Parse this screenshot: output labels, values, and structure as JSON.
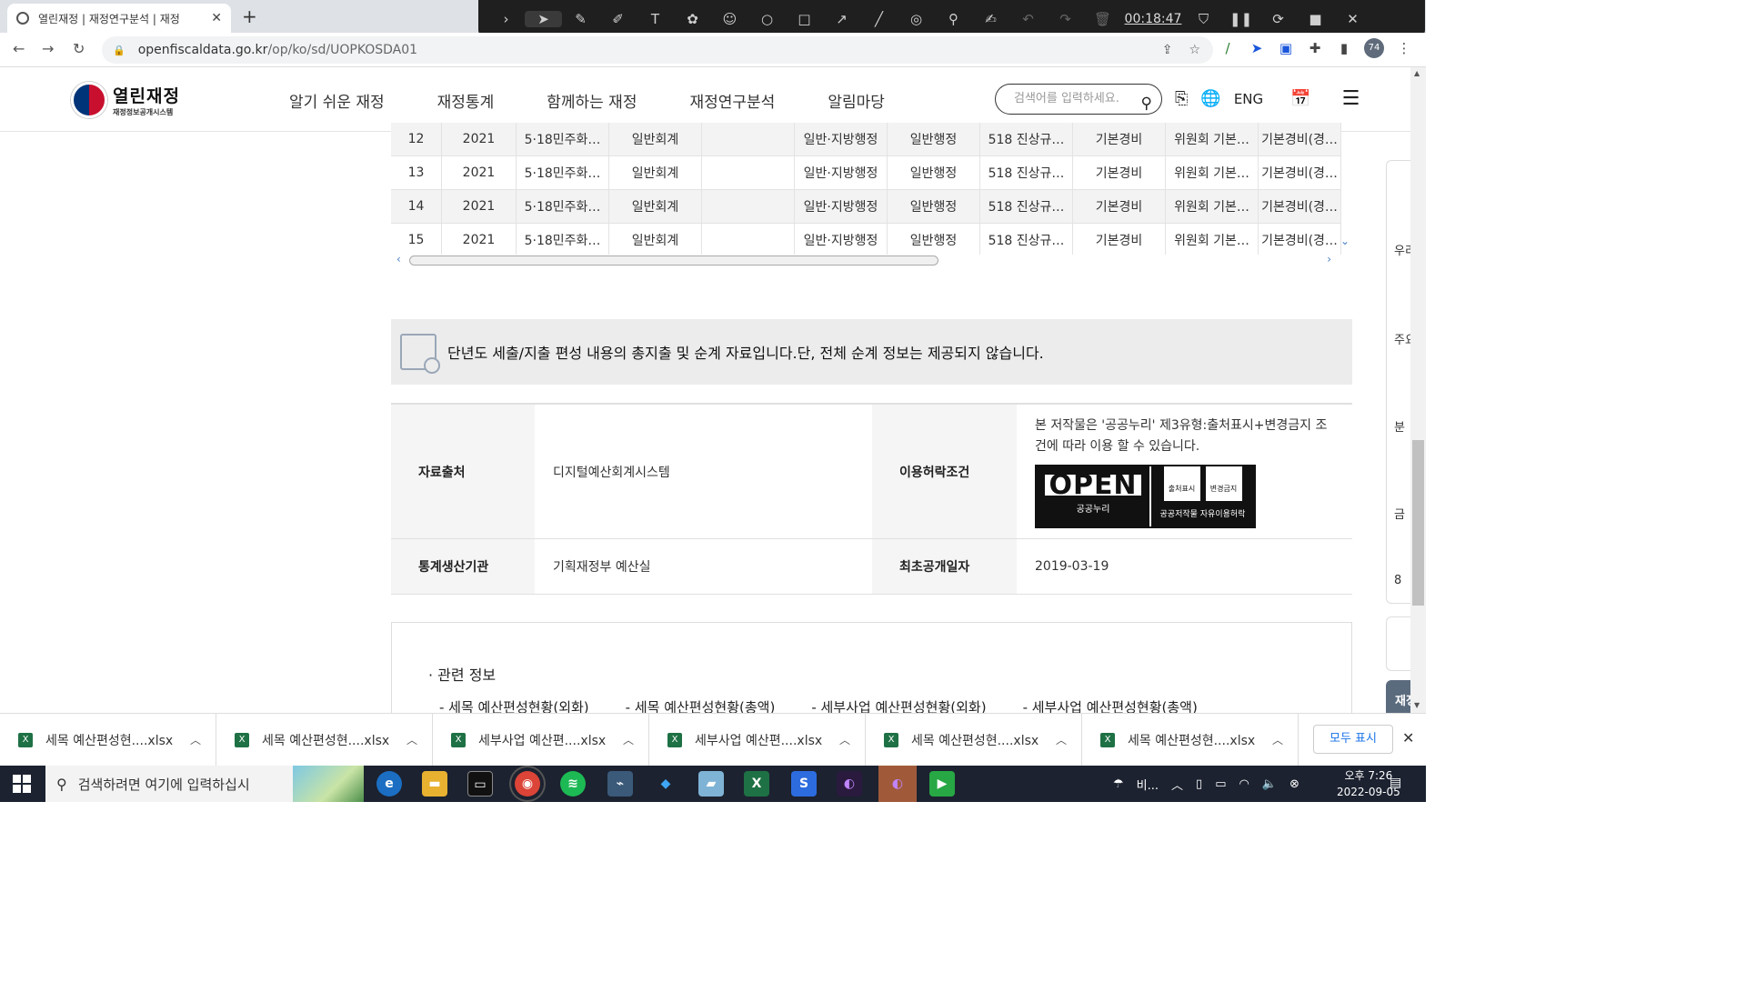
{
  "browser": {
    "tab_title": "열린재정 | 재정연구분석 | 재정",
    "url_host": "openfiscaldata.go.kr",
    "url_path": "/op/ko/sd/UOPKOSDA01",
    "profile_badge": "74"
  },
  "recorder": {
    "timer": "00:18:47"
  },
  "site": {
    "logo_title": "열린재정",
    "logo_subtitle": "재정정보공개시스템",
    "nav": [
      "알기 쉬운 재정",
      "재정통계",
      "함께하는 재정",
      "재정연구분석",
      "알림마당"
    ],
    "search_placeholder": "검색어를 입력하세요.",
    "lang": "ENG"
  },
  "table": {
    "rows": [
      [
        "12",
        "2021",
        "5·18민주화…",
        "일반회계",
        "",
        "일반·지방행정",
        "일반행정",
        "518 진상규…",
        "기본경비",
        "위원회 기본…",
        "기본경비(경…"
      ],
      [
        "13",
        "2021",
        "5·18민주화…",
        "일반회계",
        "",
        "일반·지방행정",
        "일반행정",
        "518 진상규…",
        "기본경비",
        "위원회 기본…",
        "기본경비(경…"
      ],
      [
        "14",
        "2021",
        "5·18민주화…",
        "일반회계",
        "",
        "일반·지방행정",
        "일반행정",
        "518 진상규…",
        "기본경비",
        "위원회 기본…",
        "기본경비(경…"
      ],
      [
        "15",
        "2021",
        "5·18민주화…",
        "일반회계",
        "",
        "일반·지방행정",
        "일반행정",
        "518 진상규…",
        "기본경비",
        "위원회 기본…",
        "기본경비(경…"
      ]
    ]
  },
  "notice": {
    "text": "단년도 세출/지출 편성 내용의 총지출 및 순계 자료입니다.단, 전체 순계 정보는 제공되지 않습니다."
  },
  "info": {
    "source_label": "자료출처",
    "source_value": "디지털예산회계시스템",
    "license_label": "이용허락조건",
    "license_line1": "본 저작물은 '공공누리' 제3유형:출처표시+변경금지 조",
    "license_line2": "건에 따라 이용 할 수 있습니다.",
    "open_logo": "OPEN",
    "open_logo_sub": "공공누리",
    "open_icon1": "출처표시",
    "open_icon2": "변경금지",
    "open_logo_right": "공공저작물 자유이용허락",
    "producer_label": "통계생산기관",
    "producer_value": "기획재정부 예산실",
    "date_label": "최초공개일자",
    "date_value": "2019-03-19"
  },
  "related": {
    "title": "관련 정보",
    "links": [
      "- 세목 예산편성현황(외화)",
      "- 세목 예산편성현황(총액)",
      "- 세부사업 예산편성현황(외화)",
      "- 세부사업 예산편성현황(총액)"
    ]
  },
  "side": {
    "labels": [
      "우리",
      "주요",
      "분",
      "금",
      "8"
    ],
    "bottom": "재정"
  },
  "downloads": {
    "items": [
      "세목 예산편성현....xlsx",
      "세목 예산편성현....xlsx",
      "세부사업 예산편....xlsx",
      "세부사업 예산편....xlsx",
      "세목 예산편성현....xlsx",
      "세목 예산편성현....xlsx"
    ],
    "show_all": "모두 표시"
  },
  "taskbar": {
    "search_placeholder": "검색하려면 여기에 입력하십시",
    "weather": "비...",
    "time": "오후 7:26",
    "date": "2022-09-05"
  }
}
